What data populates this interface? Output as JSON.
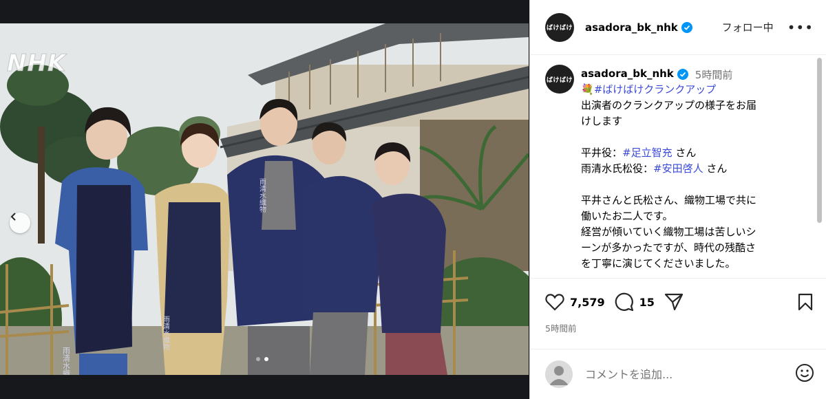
{
  "media": {
    "watermark": "NHK",
    "carousel": {
      "total": 2,
      "current": 2
    },
    "apron_lettering": [
      "雨清水織物",
      "雨清水織物",
      "雨清水織物"
    ]
  },
  "post": {
    "header": {
      "avatar_text": "ばけばけ",
      "username": "asadora_bk_nhk",
      "follow_state": "フォロー中",
      "more_label": "•••"
    },
    "caption": {
      "avatar_text": "ばけばけ",
      "username": "asadora_bk_nhk",
      "time": "5時間前",
      "lines": [
        {
          "emoji": "💐",
          "tag": "#ばけばけクランクアップ",
          "text": ""
        },
        {
          "text": "出演者のクランクアップの様子をお届"
        },
        {
          "text": "けします"
        },
        {
          "text": ""
        },
        {
          "text": "平井役：",
          "tag": "#足立智充",
          "suffix": " さん"
        },
        {
          "text": "雨清水氏松役：",
          "tag": "#安田啓人",
          "suffix": " さん"
        },
        {
          "text": ""
        },
        {
          "text": "平井さんと氏松さん、織物工場で共に"
        },
        {
          "text": "働いたお二人です。"
        },
        {
          "text": "経営が傾いていく織物工場は苦しいシ"
        },
        {
          "text": "ーンが多かったですが、時代の残酷さ"
        },
        {
          "text": "を丁寧に演じてくださいました。"
        }
      ]
    },
    "actions": {
      "likes": "7,579",
      "comments": "15",
      "time_ago": "5時間前"
    },
    "comment_box": {
      "placeholder": "コメントを追加..."
    }
  },
  "colors": {
    "link": "#3b4ad9",
    "verified": "#0095f6",
    "muted": "#737373",
    "media_bg": "#16181c"
  }
}
